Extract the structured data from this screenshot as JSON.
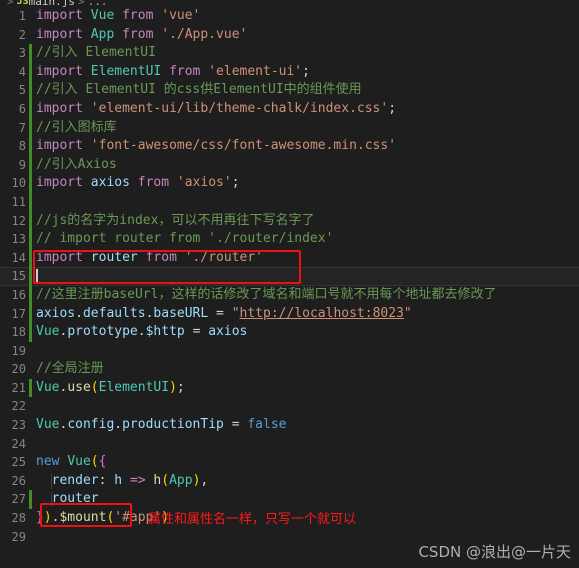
{
  "breadcrumb": {
    "icon_label": "JS",
    "file": "main.js",
    "separator": ">",
    "trailing": "..."
  },
  "editor": {
    "language": "javascript",
    "current_line": 15,
    "theme_background": "#1e1e1e",
    "colors": {
      "background": "#1e1e1e",
      "gutter_text": "#858585",
      "keyword": "#c586c0",
      "control": "#569cd6",
      "type": "#4ec9b0",
      "variable": "#9cdcfe",
      "string": "#ce9178",
      "comment": "#6a9955",
      "punctuation": "#d4d4d4",
      "change_bar": "#4a8a26",
      "annotation_red": "#ff1a1a"
    }
  },
  "lines": [
    {
      "n": 1,
      "modified": false,
      "indent": false,
      "text": "import Vue from 'vue'"
    },
    {
      "n": 2,
      "modified": false,
      "indent": false,
      "text": "import App from './App.vue'"
    },
    {
      "n": 3,
      "modified": true,
      "indent": false,
      "text": "//引入 ElementUI"
    },
    {
      "n": 4,
      "modified": true,
      "indent": false,
      "text": "import ElementUI from 'element-ui';"
    },
    {
      "n": 5,
      "modified": true,
      "indent": false,
      "text": "//引入 ElementUI 的css供ElementUI中的组件使用"
    },
    {
      "n": 6,
      "modified": true,
      "indent": false,
      "text": "import 'element-ui/lib/theme-chalk/index.css';"
    },
    {
      "n": 7,
      "modified": true,
      "indent": false,
      "text": "//引入图标库"
    },
    {
      "n": 8,
      "modified": true,
      "indent": false,
      "text": "import 'font-awesome/css/font-awesome.min.css'"
    },
    {
      "n": 9,
      "modified": true,
      "indent": false,
      "text": "//引入Axios"
    },
    {
      "n": 10,
      "modified": true,
      "indent": false,
      "text": "import axios from 'axios';"
    },
    {
      "n": 11,
      "modified": true,
      "indent": false,
      "text": ""
    },
    {
      "n": 12,
      "modified": true,
      "indent": false,
      "text": "//js的名字为index，可以不用再往下写名字了"
    },
    {
      "n": 13,
      "modified": true,
      "indent": false,
      "text": "// import router from './router/index'"
    },
    {
      "n": 14,
      "modified": true,
      "indent": false,
      "text": "import router from './router'"
    },
    {
      "n": 15,
      "modified": true,
      "indent": false,
      "text": ""
    },
    {
      "n": 16,
      "modified": true,
      "indent": false,
      "text": "//这里注册baseUrl，这样的话修改了域名和端口号就不用每个地址都去修改了"
    },
    {
      "n": 17,
      "modified": true,
      "indent": false,
      "text": "axios.defaults.baseURL = \"http://localhost:8023\""
    },
    {
      "n": 18,
      "modified": true,
      "indent": false,
      "text": "Vue.prototype.$http = axios"
    },
    {
      "n": 19,
      "modified": false,
      "indent": false,
      "text": ""
    },
    {
      "n": 20,
      "modified": false,
      "indent": false,
      "text": "//全局注册"
    },
    {
      "n": 21,
      "modified": true,
      "indent": false,
      "text": "Vue.use(ElementUI);"
    },
    {
      "n": 22,
      "modified": false,
      "indent": false,
      "text": ""
    },
    {
      "n": 23,
      "modified": false,
      "indent": false,
      "text": "Vue.config.productionTip = false"
    },
    {
      "n": 24,
      "modified": false,
      "indent": false,
      "text": ""
    },
    {
      "n": 25,
      "modified": false,
      "indent": false,
      "text": "new Vue({"
    },
    {
      "n": 26,
      "modified": false,
      "indent": true,
      "text": "  render: h => h(App),"
    },
    {
      "n": 27,
      "modified": true,
      "indent": true,
      "text": "  router"
    },
    {
      "n": 28,
      "modified": false,
      "indent": false,
      "text": "}).$mount('#app')"
    },
    {
      "n": 29,
      "modified": false,
      "indent": false,
      "text": ""
    }
  ],
  "annotations": {
    "import_box_label": "",
    "router_note": "属性和属性名一样，只写一个就可以"
  },
  "watermark": {
    "text": "CSDN @浪出@一片天"
  }
}
